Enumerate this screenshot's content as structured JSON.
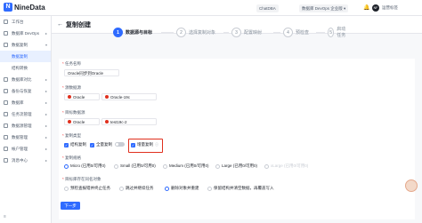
{
  "app": {
    "logo_text": "NineData"
  },
  "topbar": {
    "user_pill": "ChatDBA",
    "org_pill": "数据库 DevOps 企业版",
    "chevron": "▾",
    "bell": "🔔",
    "user_badge": "NF",
    "settings_label": "运营标签"
  },
  "sidebar": {
    "items": [
      {
        "label": "工作台",
        "icon": "home-icon"
      },
      {
        "label": "数据库 DevOps",
        "icon": "devops-icon",
        "arrow": "▸"
      },
      {
        "label": "数据复制",
        "icon": "replication-icon",
        "arrow": "▾"
      },
      {
        "label": "数据复制",
        "sub": true,
        "active": true
      },
      {
        "label": "结构转换",
        "sub": true
      },
      {
        "label": "数据库对比",
        "icon": "compare-icon",
        "arrow": "▸"
      },
      {
        "label": "备份与恢复",
        "icon": "backup-icon",
        "arrow": "▸"
      },
      {
        "label": "数据库",
        "icon": "database-icon",
        "arrow": "▸"
      },
      {
        "label": "任务流管理",
        "icon": "task-icon",
        "arrow": "▸"
      },
      {
        "label": "数据源管理",
        "icon": "datasource-icon",
        "arrow": "▸"
      },
      {
        "label": "数据管理",
        "icon": "datamgmt-icon",
        "arrow": "▸"
      },
      {
        "label": "帐户管理",
        "icon": "account-icon",
        "arrow": "▸"
      },
      {
        "label": "消息中心",
        "icon": "message-icon",
        "arrow": "▸"
      }
    ],
    "collapse": "≡"
  },
  "page": {
    "back": "←",
    "title": "复制创建"
  },
  "steps": [
    {
      "num": "1",
      "label": "数据源与目标",
      "current": true
    },
    {
      "num": "2",
      "label": "选择复制对象"
    },
    {
      "num": "3",
      "label": "配置映射"
    },
    {
      "num": "4",
      "label": "预检查"
    },
    {
      "num": "5",
      "label": "启动任务"
    }
  ],
  "form": {
    "task_name_label": "任务名称",
    "task_name_value": "Oracle同步到Oracle",
    "source_label": "源数据源",
    "source_type": "Oracle",
    "source_instance": "Oracle-19c",
    "target_label": "目标数据源",
    "target_type": "Oracle",
    "target_instance": "test19c-2",
    "copy_type_label": "复制类型",
    "copy_types": [
      {
        "label": "结构复制",
        "checked": true
      },
      {
        "label": "全量复制",
        "checked": true
      },
      {
        "label": "增量复制",
        "checked": true
      }
    ],
    "spec_label": "复制规格",
    "specs": [
      {
        "label": "Micro (已用0/可用0)",
        "selected": true
      },
      {
        "label": "Small (已用0/可用0)",
        "selected": false
      },
      {
        "label": "Medium (已用0/可用0)",
        "selected": false
      },
      {
        "label": "Large (已用0/可用0)",
        "selected": false
      },
      {
        "label": "xLarge (已用0/可用0)",
        "selected": false
      }
    ],
    "conflict_label": "目标库存在同名对象",
    "conflicts": [
      {
        "label": "预检查报错并终止任务",
        "selected": false
      },
      {
        "label": "跳过并继续任务",
        "selected": false
      },
      {
        "label": "删除对象并重建",
        "selected": true
      },
      {
        "label": "保留结构并清空数据，再覆盖写入",
        "selected": false
      }
    ],
    "next_button": "下一步"
  },
  "colors": {
    "accent": "#2f6bff",
    "highlight": "#e0301e",
    "oracle": "#e0301e"
  }
}
